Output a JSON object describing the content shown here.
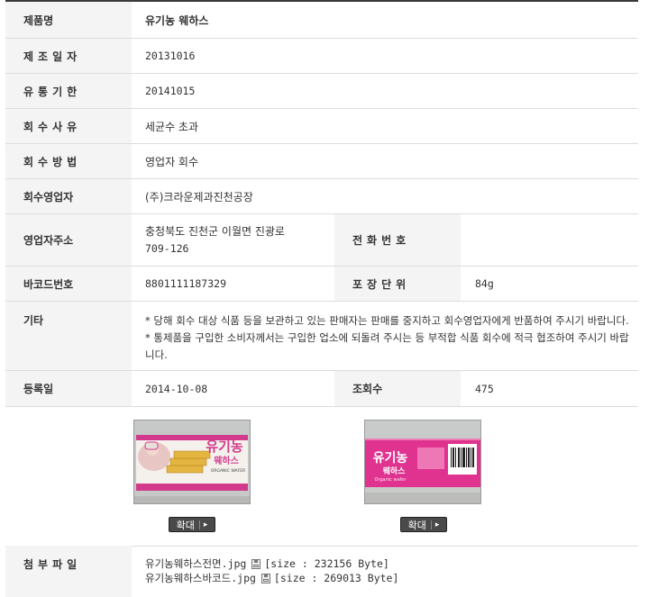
{
  "product_name": {
    "label": "제품명",
    "value": "유기농 웨하스"
  },
  "manufacture_date": {
    "label": "제조일자",
    "value": "20131016"
  },
  "expiry_date": {
    "label": "유통기한",
    "value": "20141015"
  },
  "recall_reason": {
    "label": "회수사유",
    "value": "세균수 초과"
  },
  "recall_method": {
    "label": "회수방법",
    "value": "영업자 회수"
  },
  "recall_operator": {
    "label": "회수영업자",
    "value": "(주)크라운제과진천공장"
  },
  "operator_address": {
    "label": "영업자주소",
    "value_line1": "충청북도 진천군 이월면 진광로",
    "value_line2": "709-126"
  },
  "phone": {
    "label": "전화번호",
    "value": ""
  },
  "barcode": {
    "label": "바코드번호",
    "value": "8801111187329"
  },
  "package_unit": {
    "label": "포장단위",
    "value": "84g"
  },
  "etc": {
    "label": "기타",
    "value": "* 당해 회수 대상 식품 등을 보관하고 있는 판매자는 판매를 중지하고 회수영업자에게 반품하여 주시기 바랍니다. * 통제품을 구입한 소비자께서는 구입한 업소에 되돌려 주시는 등 부적합 식품 회수에 적극 협조하여 주시기 바랍니다."
  },
  "registered": {
    "label": "등록일",
    "value": "2014-10-08"
  },
  "views": {
    "label": "조회수",
    "value": "475"
  },
  "images": [
    {
      "enlarge_label": "확대",
      "brand": "유기농",
      "sub": "웨하스",
      "caption": "ORGANIC WAFER"
    },
    {
      "enlarge_label": "확대",
      "brand": "유기농",
      "sub": "웨하스",
      "caption": "Organic wafer"
    }
  ],
  "attachments": {
    "label": "첨부파일",
    "files": [
      {
        "name": "유기농웨하스전면.jpg",
        "size": "[size : 232156 Byte]"
      },
      {
        "name": "유기농웨하스바코드.jpg",
        "size": "[size : 269013 Byte]"
      }
    ]
  },
  "colors": {
    "header_bg": "#f4f4f4",
    "border": "#dcdcdc",
    "top_line": "#3a3a3a",
    "box_pink": "#e0338f"
  }
}
